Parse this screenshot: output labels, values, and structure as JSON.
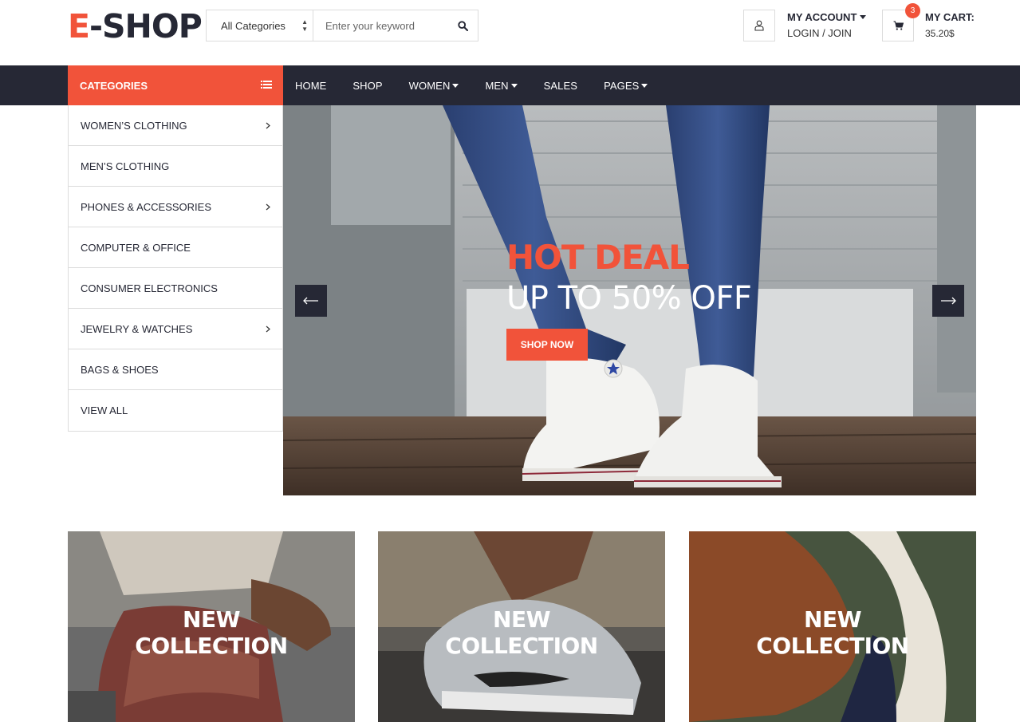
{
  "brand": {
    "logo_accent": "E",
    "logo_rest": "-SHOP",
    "accent_color": "#F1533A",
    "dark_color": "#262835"
  },
  "search": {
    "category_selected": "All Categories",
    "placeholder": "Enter your keyword",
    "button_icon": "search-icon"
  },
  "account": {
    "title": "MY ACCOUNT",
    "subtitle": "LOGIN / JOIN",
    "icon": "user-icon"
  },
  "cart": {
    "title": "MY CART:",
    "total": "35.20$",
    "count": "3",
    "icon": "shopping-cart-icon"
  },
  "categories": {
    "header": "CATEGORIES",
    "items": [
      {
        "label": "WOMEN’S CLOTHING",
        "has_submenu": true
      },
      {
        "label": "MEN’S CLOTHING",
        "has_submenu": false
      },
      {
        "label": "PHONES & ACCESSORIES",
        "has_submenu": true
      },
      {
        "label": "COMPUTER & OFFICE",
        "has_submenu": false
      },
      {
        "label": "CONSUMER ELECTRONICS",
        "has_submenu": false
      },
      {
        "label": "JEWELRY & WATCHES",
        "has_submenu": true
      },
      {
        "label": "BAGS & SHOES",
        "has_submenu": false
      },
      {
        "label": "VIEW ALL",
        "has_submenu": false
      }
    ]
  },
  "nav": {
    "items": [
      {
        "label": "HOME",
        "dropdown": false
      },
      {
        "label": "SHOP",
        "dropdown": false
      },
      {
        "label": "WOMEN",
        "dropdown": true
      },
      {
        "label": "MEN",
        "dropdown": true
      },
      {
        "label": "SALES",
        "dropdown": false
      },
      {
        "label": "PAGES",
        "dropdown": true
      }
    ]
  },
  "hero": {
    "headline": "HOT DEAL",
    "subheadline": "UP TO 50% OFF",
    "cta": "SHOP NOW"
  },
  "collections": [
    {
      "line1": "NEW",
      "line2": "COLLECTION"
    },
    {
      "line1": "NEW",
      "line2": "COLLECTION"
    },
    {
      "line1": "NEW",
      "line2": "COLLECTION"
    }
  ]
}
